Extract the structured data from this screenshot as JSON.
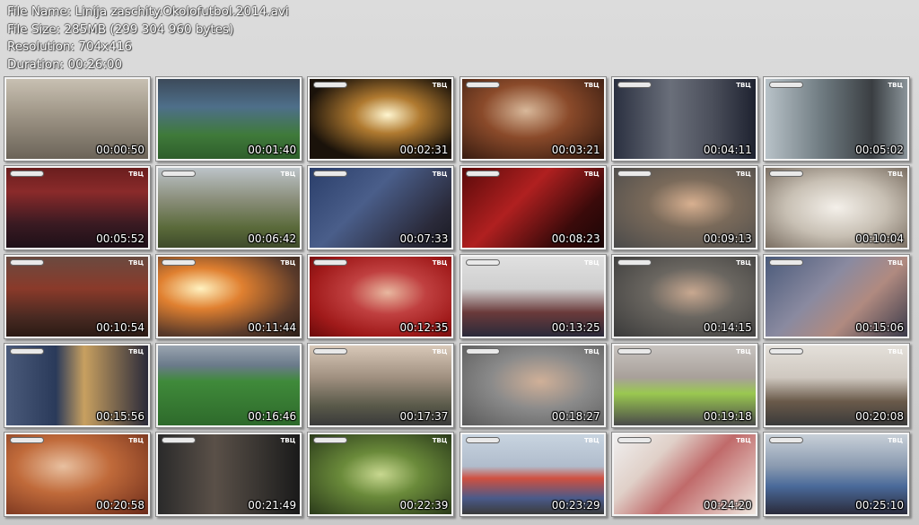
{
  "meta": {
    "file_name": "File Name: Linija zaschity.Okolofutbol.2014.avi",
    "file_size": "File Size: 285MB (299 304 960 bytes)",
    "resolution": "Resolution: 704x416",
    "duration": "Duration: 00:26:00"
  },
  "thumbnails": [
    {
      "time": "00:00:50",
      "bg": "linear-gradient(#c8c0b2 0%, #9e9586 45%, #6b6358 100%)",
      "channel": false
    },
    {
      "time": "00:01:40",
      "bg": "linear-gradient(#3c4a5a 0%, #4e6f8a 35%, #3f7a3a 70%, #2e5e2b 100%)",
      "channel": false
    },
    {
      "time": "00:02:31",
      "bg": "radial-gradient(ellipse at 55% 45%, #fff6d0 0%, #b07a30 30%, #1a120a 75%)",
      "channel": true
    },
    {
      "time": "00:03:21",
      "bg": "radial-gradient(ellipse at 45% 40%, #d8b89a 0%, #8a4a2a 40%, #2a140c 100%)",
      "channel": true
    },
    {
      "time": "00:04:11",
      "bg": "linear-gradient(90deg, #2a3040 0%, #6a6f7a 40%, #4a4e5a 70%, #1e2230 100%)",
      "channel": true
    },
    {
      "time": "00:05:02",
      "bg": "linear-gradient(90deg, #b8c2c8 0%, #6e7a80 40%, #3a3e42 75%, #8a9499 100%)",
      "channel": true
    },
    {
      "time": "00:05:52",
      "bg": "linear-gradient(#6a1e1e 0%, #8a2a2a 30%, #3a1a22 70%, #1e1018 100%)",
      "channel": true
    },
    {
      "time": "00:06:42",
      "bg": "linear-gradient(#bcc3c8 0%, #8a8e7a 40%, #5a6a3a 75%, #3e4a2a 100%)",
      "channel": true
    },
    {
      "time": "00:07:33",
      "bg": "linear-gradient(135deg, #2a3e6a 0%, #4a5e8a 40%, #2a2a3a 80%, #1a1a22 100%)",
      "channel": true
    },
    {
      "time": "00:08:23",
      "bg": "linear-gradient(135deg, #5a0a0a 0%, #b02020 40%, #3a0a0a 75%, #1a0606 100%)",
      "channel": true
    },
    {
      "time": "00:09:13",
      "bg": "radial-gradient(ellipse at 55% 45%, #d8b090 0%, #7a6a5a 40%, #4a4a4a 100%)",
      "channel": true
    },
    {
      "time": "00:10:04",
      "bg": "radial-gradient(ellipse at 50% 50%, #f4f0ea 0%, #c8c0b4 50%, #7a6e62 100%)",
      "channel": true
    },
    {
      "time": "00:10:54",
      "bg": "linear-gradient(#6a4a40 0%, #8a3a2a 40%, #4a2a22 75%, #2a1a14 100%)",
      "channel": true
    },
    {
      "time": "00:11:44",
      "bg": "radial-gradient(ellipse at 30% 40%, #fff2c0 0%, #e08030 30%, #5a3a2a 70%, #2a1e18 100%)",
      "channel": true
    },
    {
      "time": "00:12:35",
      "bg": "radial-gradient(ellipse at 55% 45%, #e8b8a0 0%, #c04040 35%, #a01a1a 70%, #6a0a0a 100%)",
      "channel": true
    },
    {
      "time": "00:13:25",
      "bg": "linear-gradient(#e0e0e0 0%, #cfcfcf 40%, #6a3a3a 70%, #2a2a3a 100%)",
      "channel": true
    },
    {
      "time": "00:14:15",
      "bg": "radial-gradient(ellipse at 55% 45%, #c8a890 0%, #6a6660 40%, #3a3a3a 100%)",
      "channel": true
    },
    {
      "time": "00:15:06",
      "bg": "linear-gradient(135deg, #4a5a7a 0%, #8a8aa0 40%, #b08a80 65%, #3a3a4a 100%)",
      "channel": true
    },
    {
      "time": "00:15:56",
      "bg": "linear-gradient(90deg, #4a5a7a 0%, #2a3a5a 35%, #c8a060 55%, #2a2a3a 100%)",
      "channel": true
    },
    {
      "time": "00:16:46",
      "bg": "linear-gradient(#9aa4b0 0%, #6a7a8a 25%, #3f8a3a 45%, #2e6a2b 100%)",
      "channel": false
    },
    {
      "time": "00:17:37",
      "bg": "linear-gradient(#d8c8b8 0%, #a09080 40%, #5a5a4a 75%, #3a3a3a 100%)",
      "channel": true
    },
    {
      "time": "00:18:27",
      "bg": "radial-gradient(ellipse at 55% 45%, #d0b098 0%, #8a8a8a 45%, #5a5a5a 100%)",
      "channel": true
    },
    {
      "time": "00:19:18",
      "bg": "linear-gradient(#c8c4c0 0%, #a8a09a 40%, #9ac850 60%, #4a4a4a 100%)",
      "channel": true
    },
    {
      "time": "00:20:08",
      "bg": "linear-gradient(#e4e0da 0%, #cfc8c0 40%, #6a5a4a 70%, #3a3a3a 100%)",
      "channel": true
    },
    {
      "time": "00:20:58",
      "bg": "radial-gradient(ellipse at 40% 40%, #e8c0a0 0%, #c06a3a 40%, #6a2a1a 100%)",
      "channel": true
    },
    {
      "time": "00:21:49",
      "bg": "linear-gradient(90deg, #2a2a2a 0%, #5a5048 40%, #3a3632 70%, #1a1a1a 100%)",
      "channel": true
    },
    {
      "time": "00:22:39",
      "bg": "radial-gradient(ellipse at 50% 50%, #c8d890 0%, #6a8a3a 40%, #2a3a1a 100%)",
      "channel": true
    },
    {
      "time": "00:23:29",
      "bg": "linear-gradient(#c8d4e0 0%, #b0bccc 40%, #d05040 55%, #4a5a8a 80%, #3a3a3a 100%)",
      "channel": true
    },
    {
      "time": "00:24:20",
      "bg": "linear-gradient(135deg, #f0f0f0 0%, #e0d0c8 30%, #c06a6a 55%, #f0e8e0 100%)",
      "channel": true
    },
    {
      "time": "00:25:10",
      "bg": "linear-gradient(#c8d0d8 0%, #8a9ab0 40%, #4a6a9a 65%, #2a2a3a 100%)",
      "channel": true
    }
  ],
  "channel_label": "ТВЦ"
}
